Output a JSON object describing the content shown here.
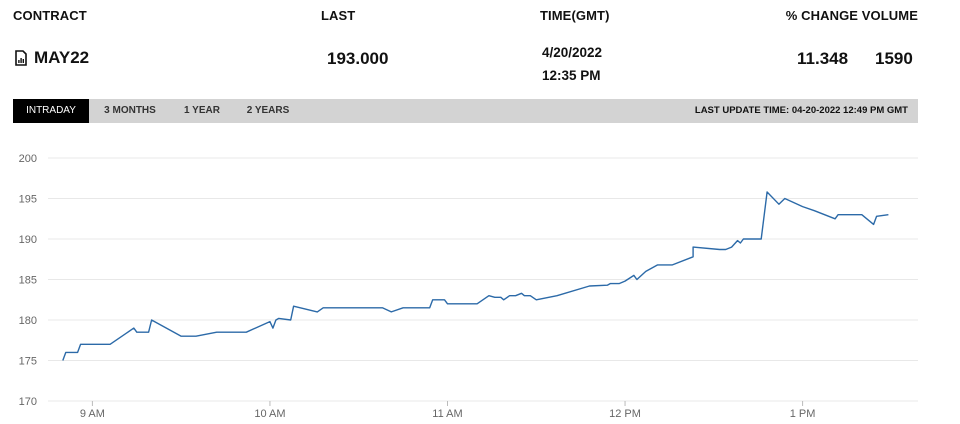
{
  "header": {
    "contract": "CONTRACT",
    "last": "LAST",
    "time": "TIME(GMT)",
    "change_volume": "% CHANGE VOLUME"
  },
  "row": {
    "icon": "chart-document-icon",
    "contract": "MAY22",
    "last": "193.000",
    "date": "4/20/2022",
    "time": "12:35 PM",
    "change": "11.348",
    "volume": "1590"
  },
  "tabs": [
    {
      "label": "INTRADAY",
      "active": true
    },
    {
      "label": "3 MONTHS",
      "active": false
    },
    {
      "label": "1 YEAR",
      "active": false
    },
    {
      "label": "2 YEARS",
      "active": false
    }
  ],
  "last_update": "LAST UPDATE TIME: 04-20-2022 12:49 PM GMT",
  "colors": {
    "line": "#2c6aa8",
    "grid": "#e8e8e8",
    "tabbar": "#d3d3d3"
  },
  "chart_data": {
    "type": "line",
    "ylim": [
      170,
      200
    ],
    "yticks": [
      170,
      175,
      180,
      185,
      190,
      195,
      200
    ],
    "xlim": [
      "08:45",
      "13:39"
    ],
    "xticks": [
      {
        "label": "9 AM",
        "t": "09:00"
      },
      {
        "label": "10 AM",
        "t": "10:00"
      },
      {
        "label": "11 AM",
        "t": "11:00"
      },
      {
        "label": "12 PM",
        "t": "12:00"
      },
      {
        "label": "1 PM",
        "t": "13:00"
      }
    ],
    "grid": true,
    "series": [
      {
        "x": [
          "08:50",
          "08:51",
          "08:55",
          "08:56",
          "09:06",
          "09:14",
          "09:15",
          "09:19",
          "09:20",
          "09:30",
          "09:35",
          "09:42",
          "09:52",
          "10:00",
          "10:01",
          "10:02",
          "10:03",
          "10:07",
          "10:08",
          "10:16",
          "10:18",
          "10:38",
          "10:41",
          "10:45",
          "10:54",
          "10:55",
          "10:59",
          "11:00",
          "11:10",
          "11:14",
          "11:16",
          "11:18",
          "11:19",
          "11:21",
          "11:22",
          "11:23",
          "11:25",
          "11:26",
          "11:28",
          "11:30",
          "11:37",
          "11:48",
          "11:54",
          "11:55",
          "11:58",
          "12:00",
          "12:03",
          "12:04",
          "12:07",
          "12:11",
          "12:16",
          "12:23",
          "12:23",
          "12:32",
          "12:34",
          "12:36",
          "12:38",
          "12:39",
          "12:40",
          "12:41",
          "12:42",
          "12:46",
          "12:48",
          "12:52",
          "12:54",
          "13:00",
          "13:04",
          "13:11",
          "13:12",
          "13:16",
          "13:20",
          "13:24",
          "13:25",
          "13:29"
        ],
        "y": [
          175.0,
          176.0,
          176.0,
          177.0,
          177.0,
          179.0,
          178.5,
          178.5,
          180.0,
          178.0,
          178.0,
          178.5,
          178.5,
          179.8,
          179.0,
          180.0,
          180.2,
          180.0,
          181.7,
          181.0,
          181.5,
          181.5,
          181.0,
          181.5,
          181.5,
          182.5,
          182.5,
          182.0,
          182.0,
          183.0,
          182.8,
          182.8,
          182.5,
          183.0,
          183.0,
          183.0,
          183.3,
          183.0,
          183.0,
          182.5,
          183.0,
          184.2,
          184.3,
          184.5,
          184.5,
          184.8,
          185.5,
          185.0,
          186.0,
          186.8,
          186.8,
          187.8,
          189.0,
          188.7,
          188.7,
          189.0,
          189.8,
          189.5,
          190.0,
          190.0,
          190.0,
          190.0,
          195.8,
          194.3,
          195.0,
          194.0,
          193.5,
          192.5,
          193.0,
          193.0,
          193.0,
          191.8,
          192.8,
          193.0
        ]
      }
    ]
  }
}
